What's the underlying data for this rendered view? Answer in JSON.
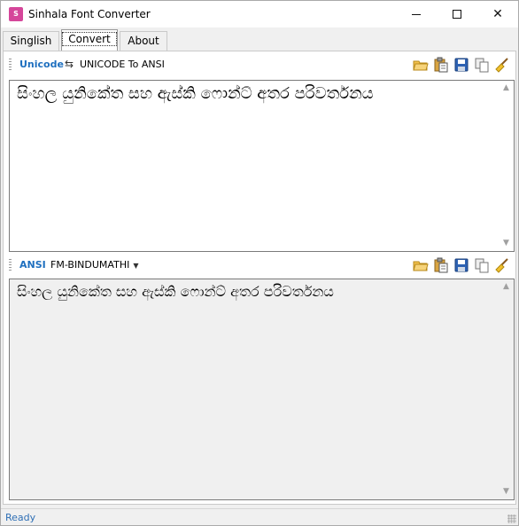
{
  "window": {
    "title": "Sinhala Font Converter",
    "app_icon": "app-icon"
  },
  "tabs": [
    {
      "label": "Singlish",
      "active": false
    },
    {
      "label": "Convert",
      "active": true
    },
    {
      "label": "About",
      "active": false
    }
  ],
  "input_section": {
    "label": "Unicode",
    "mode": "UNICODE To ANSI",
    "swap_icon": "swap-icon",
    "tool_icons": [
      "open-folder-icon",
      "paste-icon",
      "save-icon",
      "copy-icon",
      "clear-broom-icon"
    ],
    "text": "සිංහල යුනිකේත සහ ඇස්කි ෆොන්ට් අතර පරිවර්තනය"
  },
  "output_section": {
    "label": "ANSI",
    "font": "FM-BINDUMATHI",
    "tool_icons": [
      "open-folder-icon",
      "paste-icon",
      "save-icon",
      "copy-icon",
      "clear-broom-icon"
    ],
    "text": "සිංහල යුනිකේත සහ ඇස්කි ෆොන්ට් අතර පරිවර්තනය"
  },
  "status": {
    "text": "Ready"
  },
  "colors": {
    "accent": "#1e6fbf",
    "status_text": "#2f6fb5",
    "app_icon": "#d5469a"
  }
}
